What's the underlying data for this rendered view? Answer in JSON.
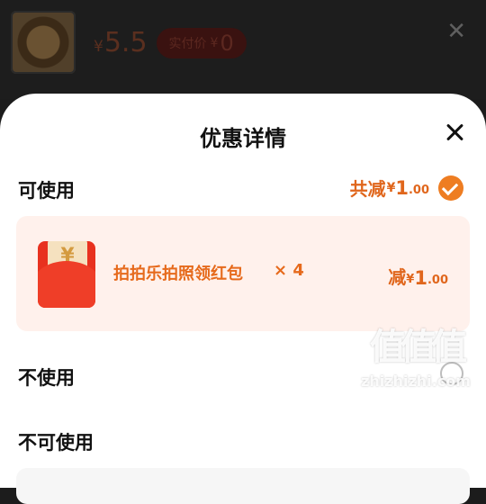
{
  "product": {
    "price_currency": "¥",
    "price": "5.5",
    "pay_label": "实付价",
    "pay_currency": "¥",
    "pay_value": "0"
  },
  "sheet": {
    "title": "优惠详情",
    "available": {
      "label": "可使用",
      "total_label": "共减",
      "total_currency": "¥",
      "total_value": "1",
      "total_decimal": ".00"
    },
    "coupon": {
      "name": "拍拍乐拍照领红包",
      "quantity": "× 4",
      "amount_label": "减",
      "currency": "¥",
      "amount": "1",
      "amount_decimal": ".00",
      "icon_glyph": "¥"
    },
    "none_label": "不使用",
    "unavailable_label": "不可使用"
  },
  "watermark": {
    "mark": "值值值",
    "text": "zhizhizhi.com"
  },
  "colors": {
    "accent": "#e0661c",
    "check": "#ee7d22",
    "coupon_bg": "#fff1ec"
  },
  "icons": [
    "close-icon",
    "checkmark-icon",
    "red-envelope-icon",
    "radio-icon"
  ]
}
